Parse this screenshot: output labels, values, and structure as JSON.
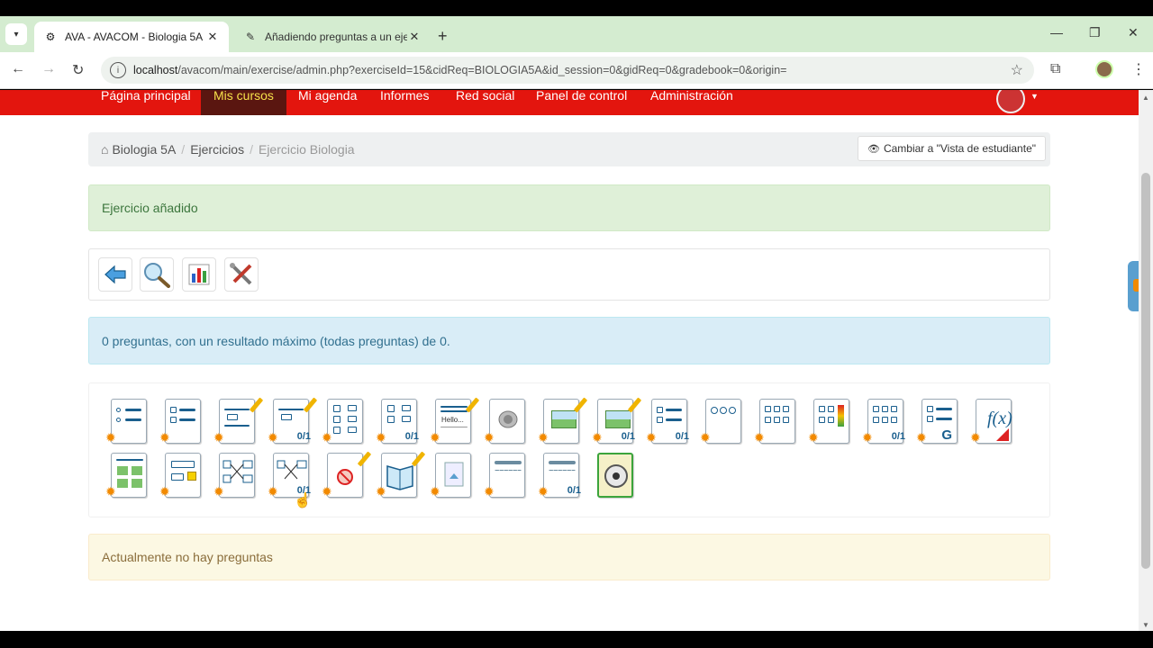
{
  "browser": {
    "tabs": [
      {
        "title": "AVA - AVACOM - Biologia 5A",
        "active": true
      },
      {
        "title": "Añadiendo preguntas a un ejer",
        "active": false
      }
    ],
    "url_host": "localhost",
    "url_path": "/avacom/main/exercise/admin.php?exerciseId=15&cidReq=BIOLOGIA5A&id_session=0&gidReq=0&gradebook=0&origin="
  },
  "nav": {
    "items": [
      "Página principal",
      "Mis cursos",
      "Mi agenda",
      "Informes",
      "Red social",
      "Panel de control",
      "Administración"
    ],
    "active_index": 1
  },
  "breadcrumb": {
    "course": "Biologia 5A",
    "section": "Ejercicios",
    "current": "Ejercicio Biologia"
  },
  "student_view_button": "Cambiar a \"Vista de estudiante\"",
  "messages": {
    "success": "Ejercicio añadido",
    "info": "0 preguntas, con un resultado máximo (todas preguntas) de 0.",
    "warning": "Actualmente no hay preguntas"
  },
  "question_type_icons": {
    "score_label": "0/1",
    "text_label": "Hello...",
    "global_label": "G",
    "formula_label": "f(x)"
  },
  "colors": {
    "nav_bg": "#e3150e",
    "nav_active_bg": "#5a1610",
    "nav_active_text": "#f5e04a",
    "tabstrip_bg": "#d4ecd0"
  }
}
